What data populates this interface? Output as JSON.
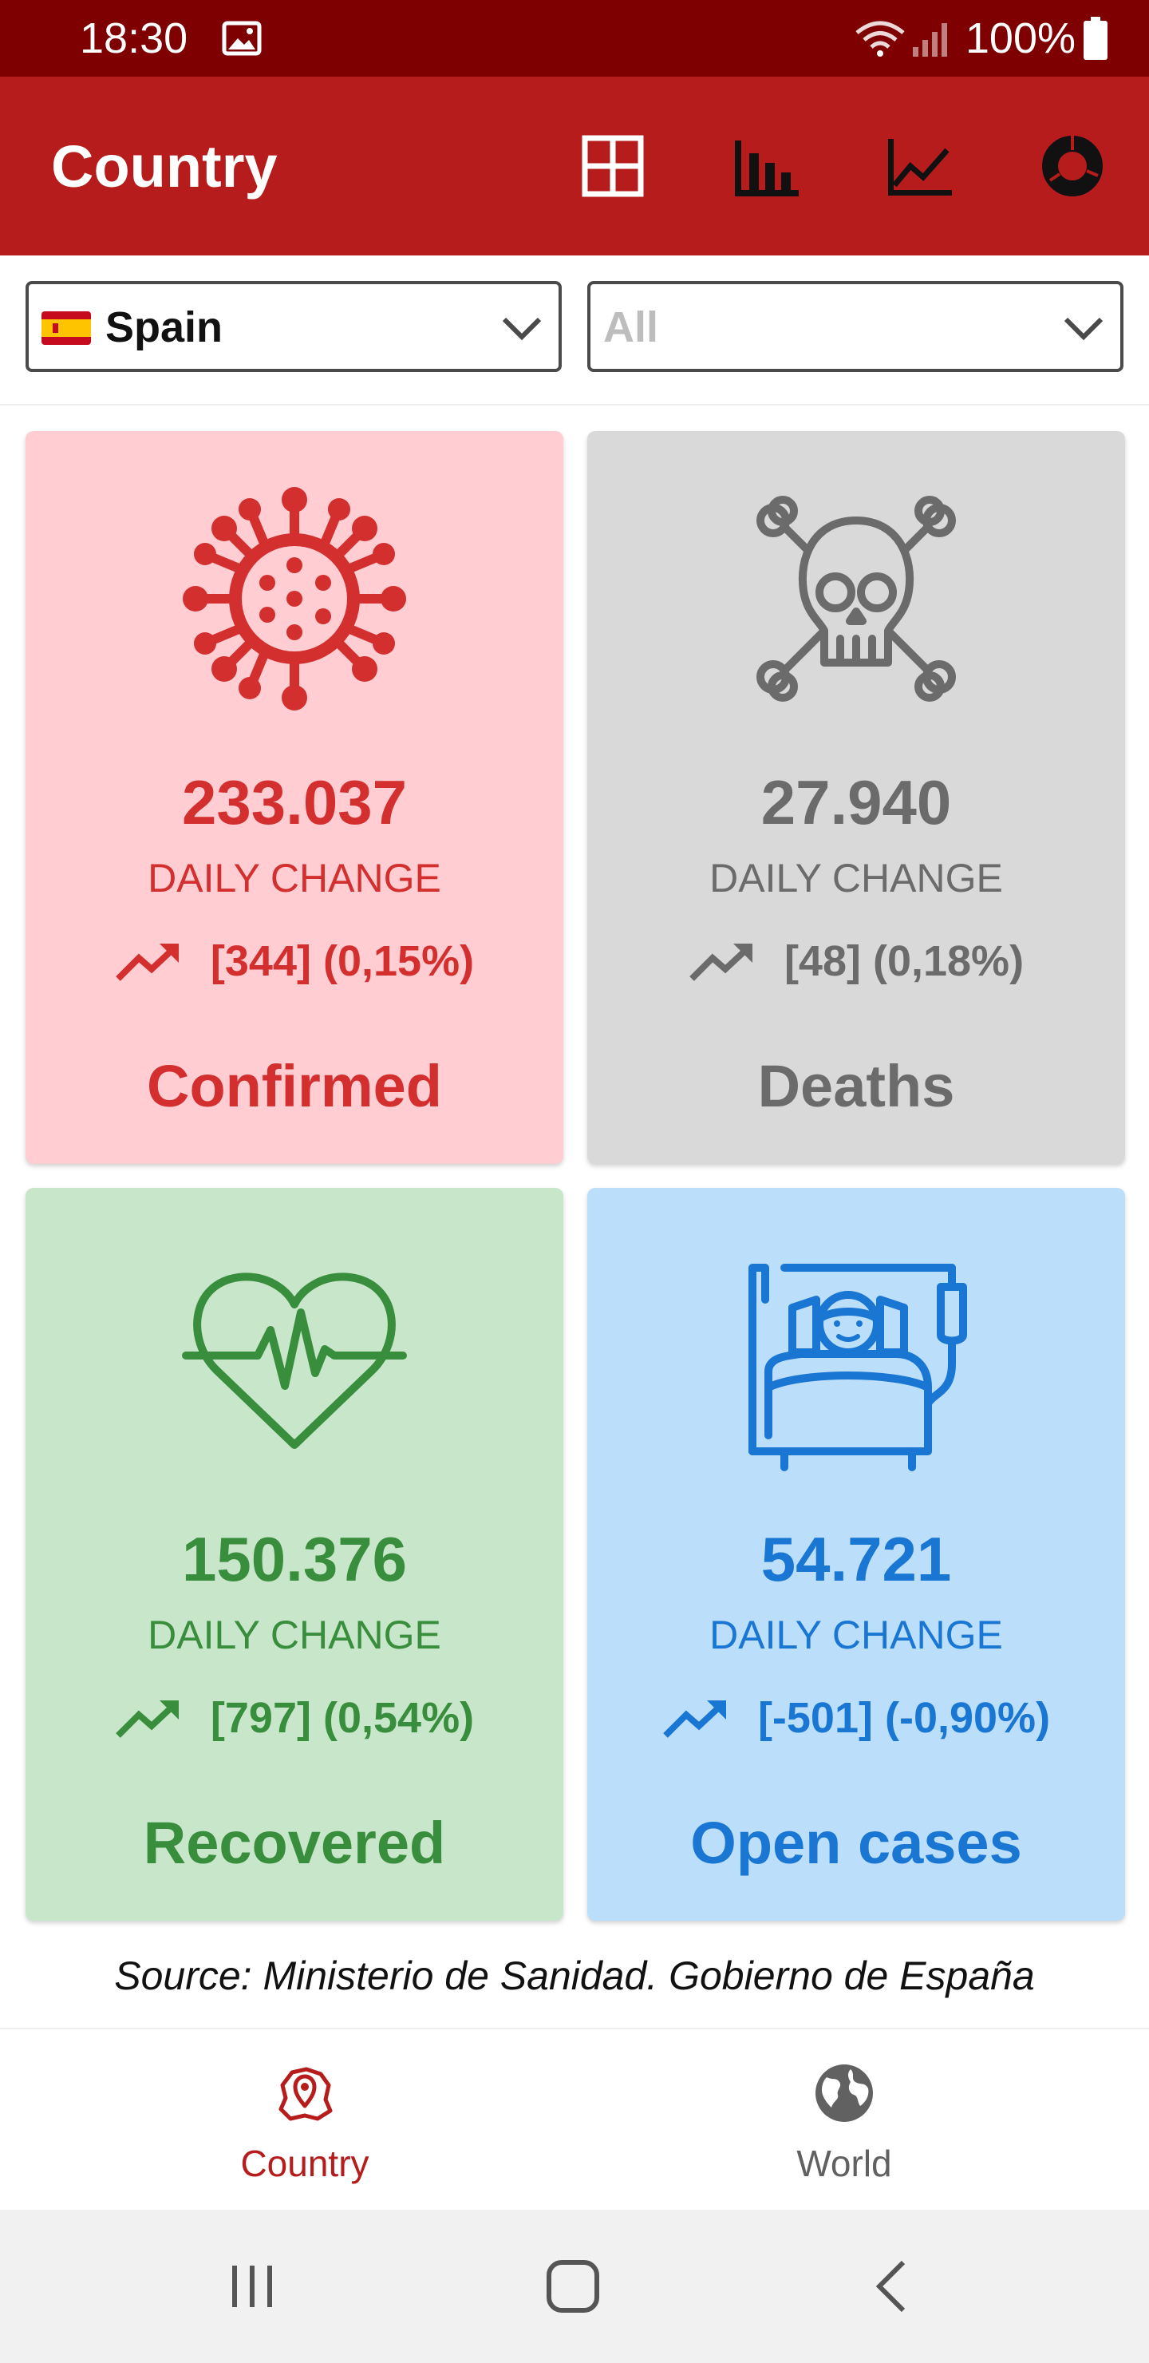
{
  "status_bar": {
    "time": "18:30",
    "battery": "100%"
  },
  "app_bar": {
    "title": "Country"
  },
  "filters": {
    "country": {
      "value": "Spain"
    },
    "region": {
      "placeholder": "All"
    }
  },
  "cards": [
    {
      "value": "233.037",
      "daily_label": "DAILY CHANGE",
      "change": "[344] (0,15%)",
      "label": "Confirmed",
      "color": "#d32f2f",
      "bg": "#ffcdd2",
      "icon": "virus-icon"
    },
    {
      "value": "27.940",
      "daily_label": "DAILY CHANGE",
      "change": "[48] (0,18%)",
      "label": "Deaths",
      "color": "#6b6b6b",
      "bg": "#d9d9d9",
      "icon": "skull-crossbones-icon"
    },
    {
      "value": "150.376",
      "daily_label": "DAILY CHANGE",
      "change": "[797] (0,54%)",
      "label": "Recovered",
      "color": "#388e3c",
      "bg": "#c8e6c9",
      "icon": "heartbeat-icon"
    },
    {
      "value": "54.721",
      "daily_label": "DAILY CHANGE",
      "change": "[-501] (-0,90%)",
      "label": "Open cases",
      "color": "#1976d2",
      "bg": "#bbdefb",
      "icon": "hospital-bed-patient-icon"
    }
  ],
  "source": "Source: Ministerio de Sanidad. Gobierno de España",
  "bottom_nav": {
    "country": "Country",
    "world": "World",
    "active_color": "#b71c1c",
    "inactive_color": "#616161"
  }
}
